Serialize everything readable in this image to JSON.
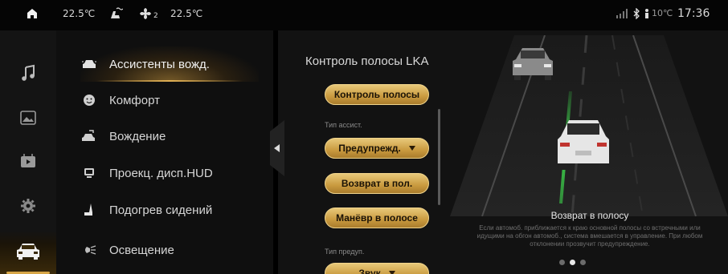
{
  "status_bar": {
    "temp_left": "22.5℃",
    "fan_level": "2",
    "temp_right": "22.5℃",
    "outside_temp": "10℃",
    "time": "17:36",
    "icons": [
      "home-icon",
      "seat-airflow-icon",
      "fan-icon",
      "signal-icon",
      "bluetooth-icon",
      "person-icon"
    ]
  },
  "rail": {
    "items": [
      {
        "name": "music-icon"
      },
      {
        "name": "gallery-icon"
      },
      {
        "name": "video-icon"
      },
      {
        "name": "settings-icon"
      },
      {
        "name": "car-icon"
      }
    ],
    "active_index": 4
  },
  "menu": {
    "items": [
      {
        "label": "Ассистенты вожд.",
        "icon": "assistant-car-icon"
      },
      {
        "label": "Комфорт",
        "icon": "comfort-face-icon"
      },
      {
        "label": "Вождение",
        "icon": "driving-icon"
      },
      {
        "label": "Проекц. дисп.HUD",
        "icon": "hud-icon"
      },
      {
        "label": "Подогрев сидений",
        "icon": "seat-heat-icon"
      },
      {
        "label": "Освещение",
        "icon": "lighting-icon"
      }
    ],
    "active_index": 0
  },
  "content": {
    "title": "Контроль полосы LKA",
    "lane_control_button": "Контроль полосы",
    "assist_type_label": "Тип ассист.",
    "assist_type_value": "Предупрежд.",
    "return_button": "Возврат в пол.",
    "maneuver_button": "Манёвр в полосе",
    "warning_type_label": "Тип предуп.",
    "warning_type_value": "Звук"
  },
  "illustration": {
    "caption_title": "Возврат в полосу",
    "caption_text": "Если автомоб. приближается к краю основной полосы со встречными или идущими на обгон автомоб., система вмешается в управление. При любом отклонении прозвучит предупреждение.",
    "pager_count": 3,
    "pager_active": 1,
    "accent_color": "#d7a646",
    "lane_line_color": "#3ccf4a"
  }
}
